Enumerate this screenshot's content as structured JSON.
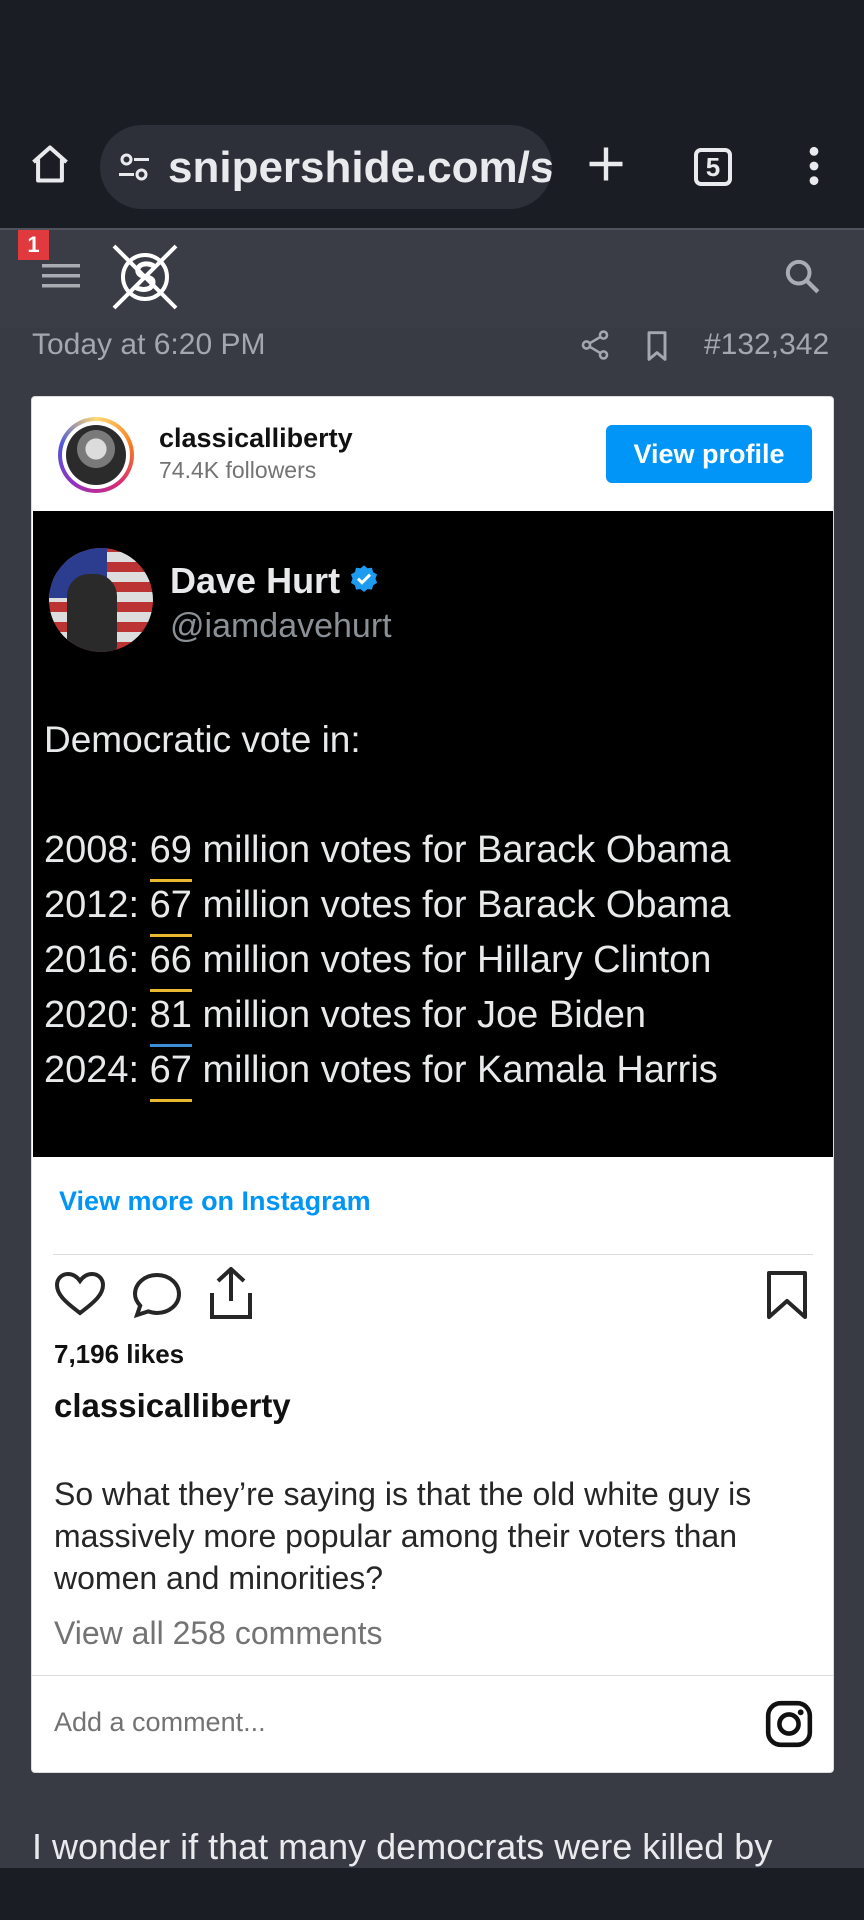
{
  "browser": {
    "url": "snipershide.com/s",
    "tab_count": "5",
    "icons": [
      "home-icon",
      "tune-icon",
      "plus-icon",
      "tab-switcher-icon",
      "more-vert-icon"
    ]
  },
  "site_header": {
    "notification_count": "1",
    "icons": [
      "hamburger-icon",
      "snipershide-logo",
      "search-icon"
    ]
  },
  "post": {
    "timestamp": "Today at 6:20 PM",
    "post_number": "#132,342",
    "reply_text": "I wonder if that many democrats were killed by"
  },
  "instagram": {
    "username": "classicalliberty",
    "followers": "74.4K followers",
    "view_profile_label": "View profile",
    "view_more_label": "View more on Instagram",
    "likes": "7,196 likes",
    "caption_user": "classicalliberty",
    "caption": "So what they’re saying is that the old white guy is massively more popular among their voters than women and minorities?",
    "view_comments": "View all 258 comments",
    "add_comment_placeholder": "Add a comment..."
  },
  "tweet": {
    "name": "Dave Hurt",
    "handle": "@iamdavehurt",
    "lead": "Democratic vote in:",
    "lines": [
      {
        "year": "2008:",
        "num": "69",
        "rest": "million votes for Barack Obama",
        "underline": "#e8b830"
      },
      {
        "year": "2012:",
        "num": "67",
        "rest": "million votes for Barack Obama",
        "underline": "#e8b830"
      },
      {
        "year": "2016:",
        "num": "66",
        "rest": "million votes for Hillary Clinton",
        "underline": "#e8b830"
      },
      {
        "year": "2020:",
        "num": "81",
        "rest": "million votes for Joe Biden",
        "underline": "#3b8fd9"
      },
      {
        "year": "2024:",
        "num": "67",
        "rest": "million votes for Kamala Harris",
        "underline": "#e8b830"
      }
    ]
  },
  "colors": {
    "ig_blue": "#0095f6",
    "badge_red": "#e0393e",
    "verified_blue": "#1d9bf0"
  }
}
